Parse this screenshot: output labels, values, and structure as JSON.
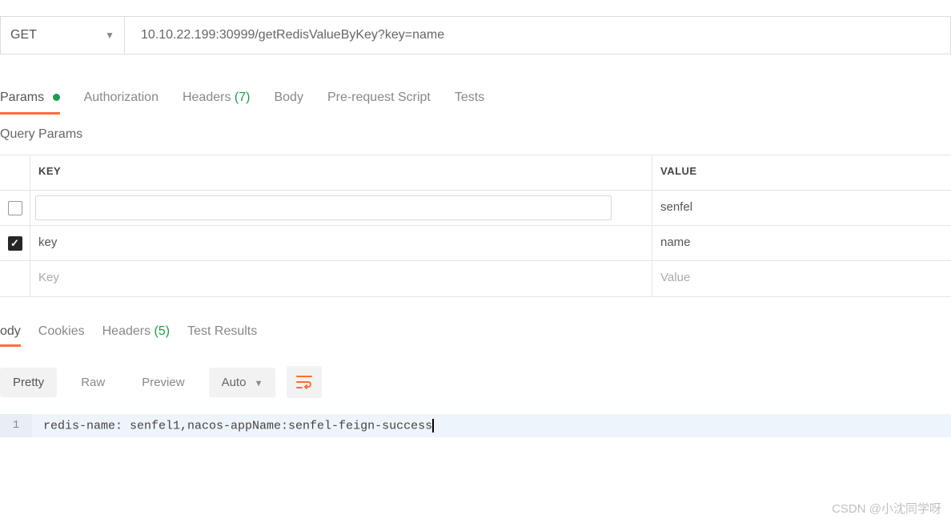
{
  "request": {
    "method": "GET",
    "url": "10.10.22.199:30999/getRedisValueByKey?key=name"
  },
  "request_tabs": {
    "params": "Params",
    "authorization": "Authorization",
    "headers": "Headers",
    "headers_count": "(7)",
    "body": "Body",
    "prerequest": "Pre-request Script",
    "tests": "Tests"
  },
  "params_section": {
    "title": "Query Params",
    "header_key": "KEY",
    "header_value": "VALUE",
    "rows": [
      {
        "checked": false,
        "key": "",
        "value": "senfel"
      },
      {
        "checked": true,
        "key": "key",
        "value": "name"
      }
    ],
    "placeholder_key": "Key",
    "placeholder_value": "Value"
  },
  "response_tabs": {
    "body": "ody",
    "cookies": "Cookies",
    "headers": "Headers",
    "headers_count": "(5)",
    "test_results": "Test Results"
  },
  "response_toolbar": {
    "pretty": "Pretty",
    "raw": "Raw",
    "preview": "Preview",
    "format": "Auto"
  },
  "response_body": {
    "line_number": "1",
    "content": "redis-name: senfel1,nacos-appName:senfel-feign-success"
  },
  "watermark": "CSDN @小沈同学呀"
}
